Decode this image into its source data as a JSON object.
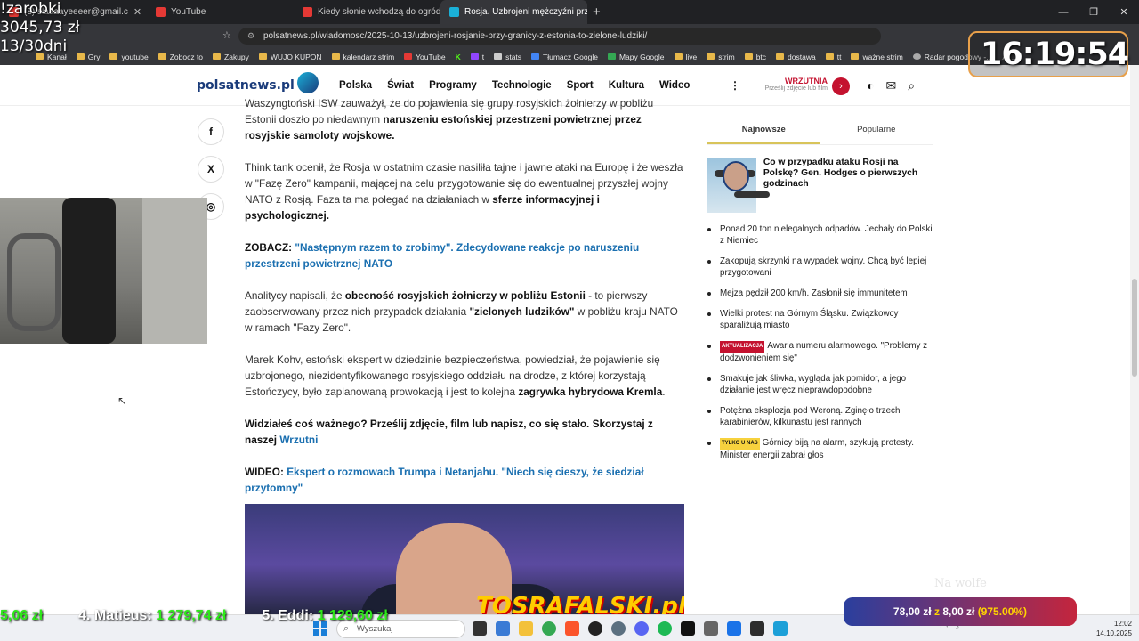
{
  "browser": {
    "tabs": [
      {
        "label": "(8) slaaaayeeeer@gmail.c",
        "active": false
      },
      {
        "label": "YouTube",
        "active": false
      },
      {
        "label": "Kiedy słonie wchodzą do ogródk",
        "active": false
      },
      {
        "label": "Rosja. Uzbrojeni mężczyźni przy",
        "active": true
      }
    ],
    "new_tab": "+",
    "window_controls": [
      "—",
      "❐",
      "✕"
    ],
    "url": "polsatnews.pl/wiadomosc/2025-10-13/uzbrojeni-rosjanie-przy-granicy-z-estonia-to-zielone-ludziki/",
    "bookmarks": [
      "Kanał",
      "Gry",
      "youtube",
      "Zobocz to",
      "Zakupy",
      "WUJO KUPON",
      "kalendarz strim",
      "YouTube",
      "K",
      "t",
      "stats",
      "Tłumacz Google",
      "Mapy Google",
      "live",
      "strim",
      "btc",
      "dostawa",
      "tt",
      "ważne strim",
      "Radar pogodowy -...",
      "Ar..."
    ]
  },
  "site": {
    "logo": "polsatnews.pl",
    "nav": [
      "Polska",
      "Świat",
      "Programy",
      "Technologie",
      "Sport",
      "Kultura",
      "Wideo"
    ],
    "more": "⋮",
    "wrzutnia_title": "WRZUTNIA",
    "wrzutnia_sub": "Prześlij zdjęcie lub film",
    "wrzutnia_arrow": "›",
    "icons": {
      "contrast": "◐",
      "mail": "✉",
      "search": "⌕"
    }
  },
  "share": [
    "f",
    "X",
    "◎"
  ],
  "article": {
    "p1": {
      "pre": "Waszyngtoński ISW zauważył, że do pojawienia się grupy rosyjskich żołnierzy w pobliżu Estonii doszło po niedawnym ",
      "bold": "naruszeniu estońskiej przestrzeni powietrznej przez rosyjskie samoloty wojskowe."
    },
    "p2": {
      "pre": "Think tank ocenił, że Rosja w ostatnim czasie nasiliła tajne i jawne ataki na Europę i że weszła w \"Fazę Zero\" kampanii, mającej na celu przygotowanie się do ewentualnej przyszłej wojny NATO z Rosją. Faza ta ma polegać na działaniach w ",
      "bold": "sferze informacyjnej i psychologicznej."
    },
    "p3": {
      "label": "ZOBACZ:",
      "link": "\"Następnym razem to zrobimy\". Zdecydowane reakcje po naruszeniu przestrzeni powietrznej NATO"
    },
    "p4": {
      "pre": "Analitycy napisali, że ",
      "b1": "obecność rosyjskich żołnierzy w pobliżu Estonii",
      "mid": " - to pierwszy zaobserwowany przez nich przypadek działania ",
      "b2": "\"zielonych ludzików\"",
      "post": " w pobliżu kraju NATO w ramach \"Fazy Zero\"."
    },
    "p5": {
      "pre": "Marek Kohv, estoński ekspert w dziedzinie bezpieczeństwa, powiedział, że pojawienie się uzbrojonego, niezidentyfikowanego rosyjskiego oddziału na drodze, z której korzystają Estończycy, było zaplanowaną prowokacją i jest to kolejna ",
      "bold": "zagrywka hybrydowa Kremla",
      "post": "."
    },
    "p6": {
      "bold": "Widziałeś coś ważnego? Prześlij zdjęcie, film lub napisz, co się stało. Skorzystaj z naszej ",
      "link": "Wrzutni"
    },
    "p7": {
      "label": "WIDEO:",
      "link": "Ekspert o rozmowach Trumpa i Netanjahu. \"Niech się cieszy, że siedział przytomny\""
    },
    "video_brand": "TOSRAFALSKI.pl"
  },
  "sidebar": {
    "tabs": [
      "Najnowsze",
      "Popularne"
    ],
    "top": "Co w przypadku ataku Rosji na Polskę? Gen. Hodges o pierwszych godzinach",
    "items": [
      {
        "badge": "",
        "text": "Ponad 20 ton nielegalnych odpadów. Jechały do Polski z Niemiec"
      },
      {
        "badge": "",
        "text": "Zakopują skrzynki na wypadek wojny. Chcą być lepiej przygotowani"
      },
      {
        "badge": "",
        "text": "Mejza pędził 200 km/h. Zasłonił się immunitetem"
      },
      {
        "badge": "",
        "text": "Wielki protest na Górnym Śląsku. Związkowcy sparaliżują miasto"
      },
      {
        "badge": "AKTUALIZACJA",
        "text": "Awaria numeru alarmowego. \"Problemy z dodzwonieniem się\""
      },
      {
        "badge": "",
        "text": "Smakuje jak śliwka, wygląda jak pomidor, a jego działanie jest wręcz nieprawdopodobne"
      },
      {
        "badge": "",
        "text": "Potężna eksplozja pod Weroną. Zginęło trzech karabinierów, kilkunastu jest rannych"
      },
      {
        "badge": "TYLKO U NAS",
        "text": "Górnicy biją na alarm, szykują protesty. Minister energii zabrał głos"
      }
    ]
  },
  "overlay": {
    "earnings_title": "!zarobki",
    "earnings_amount": "3045,73 zł",
    "days": "13/30dni",
    "clock": "16:19:54",
    "donors": [
      {
        "rank": "",
        "name": "",
        "amount": "5,06 zł"
      },
      {
        "rank": "4.",
        "name": "Matieus:",
        "amount": "1 279,74 zł"
      },
      {
        "rank": "5.",
        "name": "Eddi:",
        "amount": "1 129,60 zł"
      }
    ],
    "bet": {
      "a": "78,00 zł",
      "z": "z",
      "b": "8,00 zł",
      "pct": "(975.00%)"
    },
    "watermark": "Na wolfe"
  },
  "taskbar": {
    "search_placeholder": "Wyszukaj",
    "time": "12:02",
    "date": "14.10.2025"
  }
}
